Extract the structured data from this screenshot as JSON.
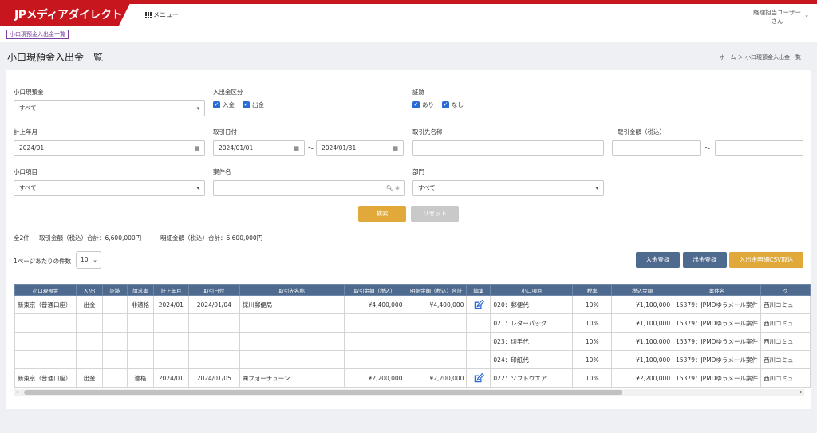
{
  "header": {
    "logo": "JPメディアダイレクト",
    "menu_label": "メニュー",
    "user_line1": "経理担当ユーザー",
    "user_line2": "さん"
  },
  "tag": "小口現預金入出金一覧",
  "page": {
    "title": "小口現預金入出金一覧",
    "breadcrumb": "ホーム ＞ 小口現預金入出金一覧"
  },
  "form": {
    "petty_cash": {
      "label": "小口現預金",
      "value": "すべて"
    },
    "in_out": {
      "label": "入出金区分",
      "opt_in": "入金",
      "opt_out": "出金"
    },
    "evidence": {
      "label": "証跡",
      "opt_yes": "あり",
      "opt_no": "なし"
    },
    "posting_month": {
      "label": "計上年月",
      "value": "2024/01"
    },
    "txn_date": {
      "label": "取引日付",
      "from": "2024/01/01",
      "to": "2024/01/31"
    },
    "counterparty": {
      "label": "取引先名称",
      "value": ""
    },
    "amount": {
      "label": "取引金額（税込）",
      "from": "",
      "to": ""
    },
    "item": {
      "label": "小口項目",
      "value": "すべて"
    },
    "project": {
      "label": "案件名",
      "value": ""
    },
    "dept": {
      "label": "部門",
      "value": "すべて"
    },
    "tilde": "～"
  },
  "buttons": {
    "search": "検索",
    "reset": "リセット",
    "deposit": "入金登録",
    "withdraw": "出金登録",
    "csv": "入出金明細CSV取込"
  },
  "summary": {
    "count": "全2件",
    "txn_total": "取引金額（税込）合計：6,600,000円",
    "detail_total": "明細金額（税込）合計：6,600,000円"
  },
  "perpage": {
    "label": "1ページあたりの件数",
    "value": "10"
  },
  "table": {
    "headers": [
      "小口現預金",
      "入/出",
      "証跡",
      "請求書",
      "計上年月",
      "取引日付",
      "取引先名称",
      "取引金額（税込）",
      "明細金額（税込）合計",
      "編集",
      "小口項目",
      "税率",
      "税込金額",
      "案件名",
      "ク"
    ],
    "rows": [
      [
        "新東京（普通口座）",
        "出金",
        "",
        "非適格",
        "2024/01",
        "2024/01/04",
        "採川郵便局",
        "¥4,400,000",
        "¥4,400,000",
        "edit",
        "020：郵便代",
        "10%",
        "¥1,100,000",
        "15379：JPMDゆうメール案件",
        "西川コミュ"
      ],
      [
        "",
        "",
        "",
        "",
        "",
        "",
        "",
        "",
        "",
        "",
        "021：レターパック",
        "10%",
        "¥1,100,000",
        "15379：JPMDゆうメール案件",
        "西川コミュ"
      ],
      [
        "",
        "",
        "",
        "",
        "",
        "",
        "",
        "",
        "",
        "",
        "023：切手代",
        "10%",
        "¥1,100,000",
        "15379：JPMDゆうメール案件",
        "西川コミュ"
      ],
      [
        "",
        "",
        "",
        "",
        "",
        "",
        "",
        "",
        "",
        "",
        "024：印紙代",
        "10%",
        "¥1,100,000",
        "15379：JPMDゆうメール案件",
        "西川コミュ"
      ],
      [
        "新東京（普通口座）",
        "出金",
        "",
        "適格",
        "2024/01",
        "2024/01/05",
        "㈱フォーチューン",
        "¥2,200,000",
        "¥2,200,000",
        "edit",
        "022：ソフトウエア",
        "10%",
        "¥2,200,000",
        "15379：JPMDゆうメール案件",
        "西川コミュ"
      ]
    ]
  }
}
